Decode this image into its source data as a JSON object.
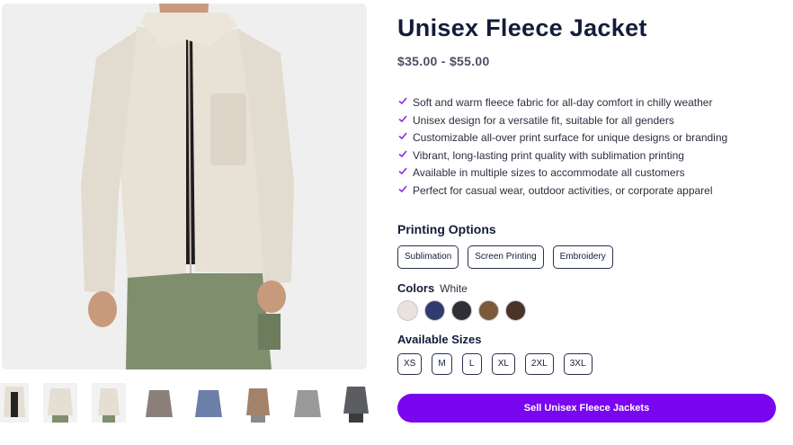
{
  "product": {
    "title": "Unisex Fleece Jacket",
    "price": "$35.00 - $55.00",
    "features": [
      "Soft and warm fleece fabric for all-day comfort in chilly weather",
      "Unisex design for a versatile fit, suitable for all genders",
      "Customizable all-over print surface for unique designs or branding",
      "Vibrant, long-lasting print quality with sublimation printing",
      "Available in multiple sizes to accommodate all customers",
      "Perfect for casual wear, outdoor activities, or corporate apparel"
    ],
    "check_icon": "check-icon",
    "check_color": "#8a2be2"
  },
  "printing": {
    "title": "Printing Options",
    "options": [
      "Sublimation",
      "Screen Printing",
      "Embroidery"
    ]
  },
  "colors": {
    "label": "Colors",
    "selected": "White",
    "swatches": [
      {
        "name": "White",
        "hex": "#e9e2de"
      },
      {
        "name": "Navy",
        "hex": "#313b6e"
      },
      {
        "name": "Charcoal",
        "hex": "#2f3036"
      },
      {
        "name": "Brown",
        "hex": "#7b5a3c"
      },
      {
        "name": "Dark Brown",
        "hex": "#4a3428"
      }
    ]
  },
  "sizes": {
    "title": "Available Sizes",
    "options": [
      "XS",
      "M",
      "L",
      "XL",
      "2XL",
      "3XL"
    ]
  },
  "cta": {
    "label": "Sell Unisex Fleece Jackets",
    "color": "#7a06f0"
  },
  "gallery": {
    "thumbnails": [
      "cream jacket front",
      "cream jacket back",
      "cream jacket side",
      "grey-brown jacket",
      "blue jacket",
      "tan jacket",
      "grey jacket",
      "charcoal jacket"
    ]
  }
}
